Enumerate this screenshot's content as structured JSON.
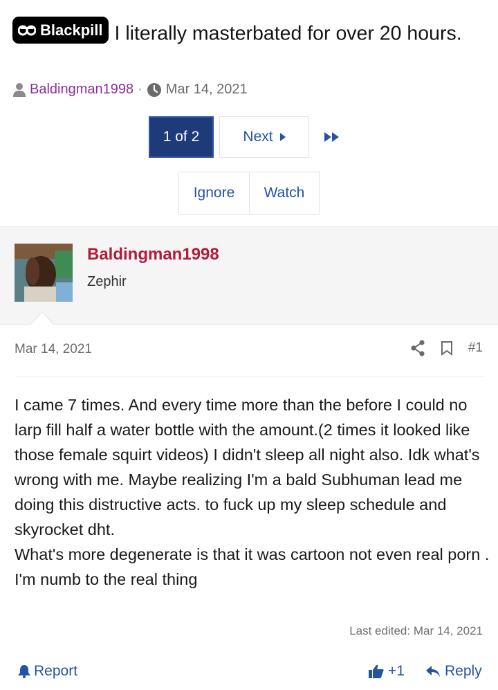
{
  "thread": {
    "prefix": "Blackpill",
    "title": "I literally masterbated for over 20 hours.",
    "author": "Baldingman1998",
    "separator": "·",
    "date": "Mar 14, 2021"
  },
  "pagination": {
    "current": "1 of 2",
    "next_label": "Next"
  },
  "thread_actions": {
    "ignore_label": "Ignore",
    "watch_label": "Watch"
  },
  "post": {
    "username": "Baldingman1998",
    "user_title": "Zephir",
    "date": "Mar 14, 2021",
    "number": "#1",
    "body": [
      "I came 7 times. And every time more than the before I could no larp fill half a water bottle with the amount.(2 times it looked like those female squirt videos) I didn't sleep all night also. Idk what's wrong with me. Maybe realizing I'm a bald Subhuman lead me doing this distructive acts. to fuck up my sleep schedule and skyrocket dht.",
      "What's more degenerate is that it was cartoon not even real porn . I'm numb to the real thing"
    ],
    "last_edited": "Last edited: Mar 14, 2021"
  },
  "post_footer": {
    "report_label": "Report",
    "reaction_label": "+1",
    "reply_label": "Reply"
  },
  "colors": {
    "accent_link": "#2553a3",
    "page_current_bg": "#1e3a78",
    "username": "#b01d3b",
    "author": "#8e2d9b"
  },
  "icons": [
    "blackpill-icon",
    "user-icon",
    "clock-icon",
    "next-triangle-icon",
    "last-page-icon",
    "share-icon",
    "bookmark-icon",
    "warning-bell-icon",
    "thumbs-up-icon",
    "reply-arrow-icon"
  ]
}
